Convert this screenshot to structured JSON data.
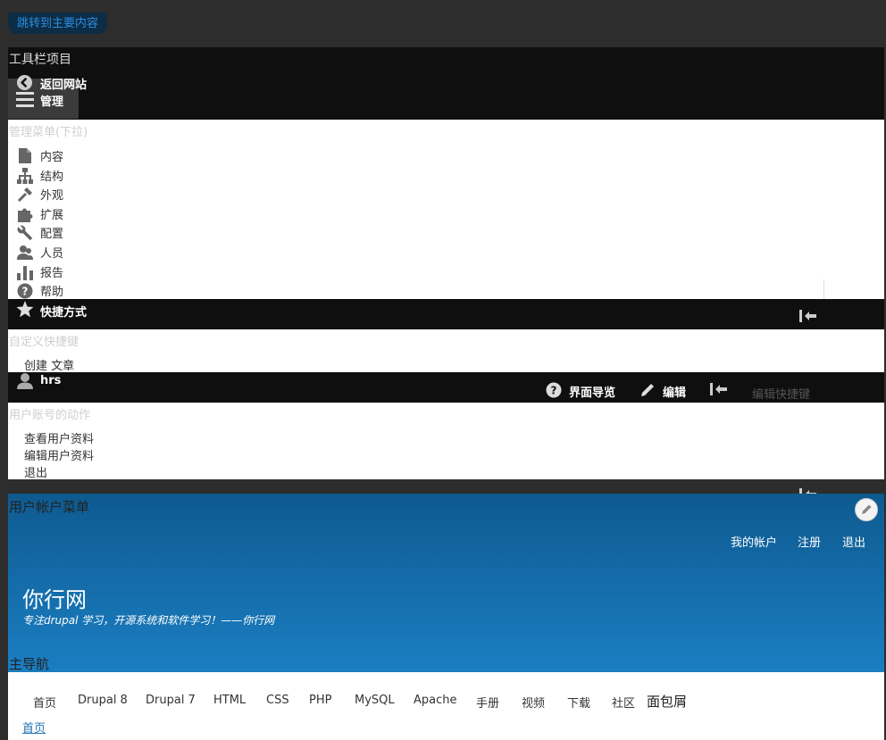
{
  "skip_link": "跳转到主要内容",
  "toolbar": {
    "label": "工具栏项目",
    "back": "返回网站",
    "manage": "管理"
  },
  "admin_menu": {
    "heading": "管理菜单(下拉)",
    "items": [
      {
        "label": "内容",
        "icon": "file-icon"
      },
      {
        "label": "结构",
        "icon": "sitemap-icon"
      },
      {
        "label": "外观",
        "icon": "brush-icon"
      },
      {
        "label": "扩展",
        "icon": "puzzle-icon"
      },
      {
        "label": "配置",
        "icon": "wrench-icon"
      },
      {
        "label": "人员",
        "icon": "people-icon"
      },
      {
        "label": "报告",
        "icon": "bar-chart-icon"
      },
      {
        "label": "帮助",
        "icon": "help-icon"
      }
    ]
  },
  "shortcuts": {
    "label": "快捷方式",
    "heading": "自定义快捷键",
    "items": [
      "创建 文章"
    ]
  },
  "user_bar": {
    "username": "hrs",
    "tour": "界面导览",
    "edit": "编辑",
    "edit_shortcuts": "编辑快捷键"
  },
  "user_actions": {
    "heading": "用户账号的动作",
    "items": [
      "查看用户资料",
      "编辑用户资料",
      "退出"
    ]
  },
  "site": {
    "account_menu_heading": "用户帐户菜单",
    "account_links": [
      "我的帐户",
      "注册",
      "退出"
    ],
    "name": "你行网",
    "slogan": "专注drupal 学习，开源系统和软件学习！——你行网",
    "main_nav_heading": "主导航",
    "main_nav": [
      "首页",
      "Drupal 8",
      "Drupal 7",
      "HTML",
      "CSS",
      "PHP",
      "MySQL",
      "Apache",
      "手册",
      "视频",
      "下载",
      "社区"
    ],
    "breadcrumb_heading": "面包屑",
    "breadcrumb": [
      "首页"
    ]
  },
  "colors": {
    "toolbar_bg": "#0f0f0f",
    "hero_top": "#0e5a90",
    "hero_bottom": "#1b7ec2",
    "link": "#2275b6"
  }
}
